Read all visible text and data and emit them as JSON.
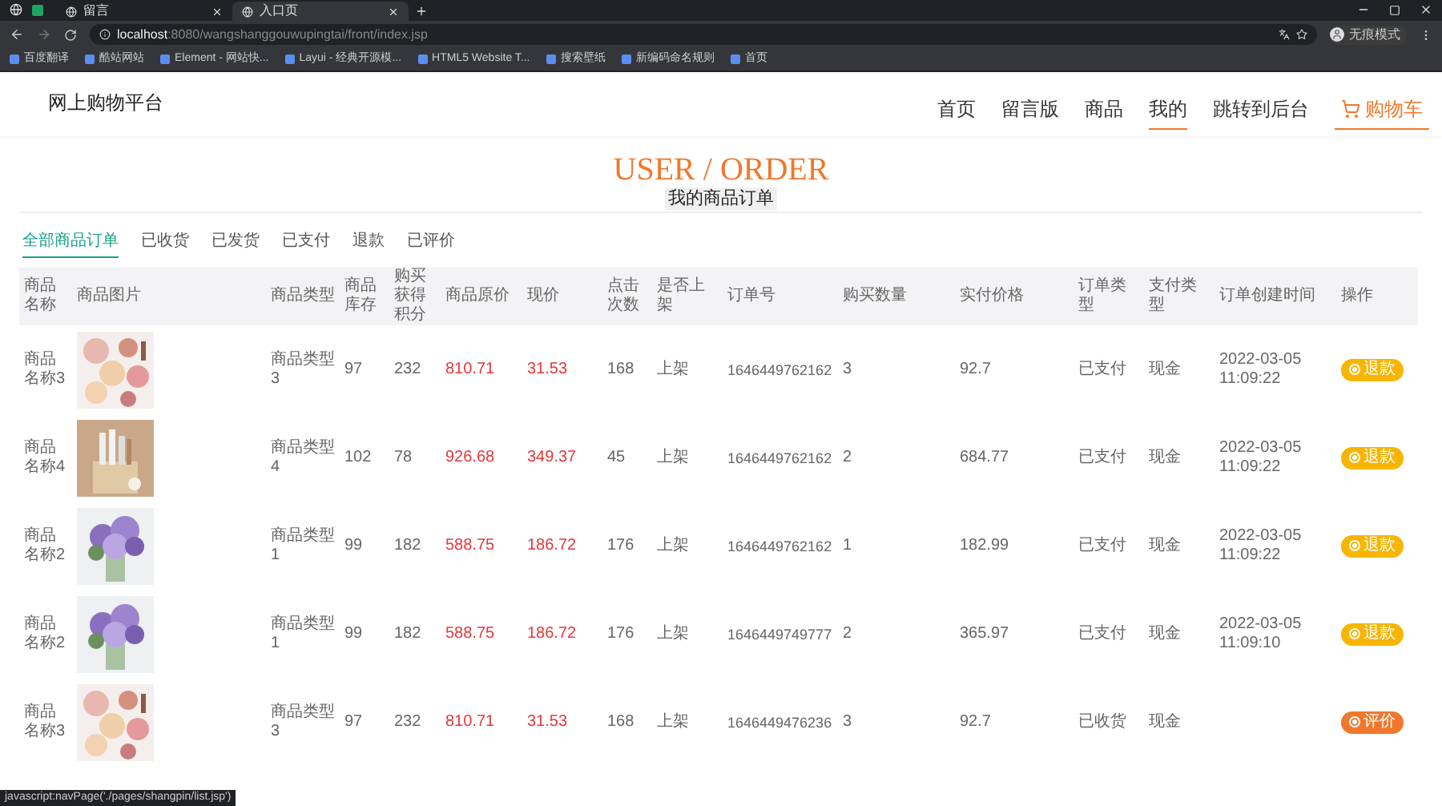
{
  "browser": {
    "tabs": [
      {
        "title": "留言",
        "selected": false
      },
      {
        "title": "入口页",
        "selected": true
      }
    ],
    "url": {
      "host": "localhost",
      "rest": ":8080/wangshanggouwupingtai/front/index.jsp"
    },
    "profile": "无痕模式",
    "bookmarks": [
      "百度翻译",
      "酷站网站",
      "Element - 网站快...",
      "Layui - 经典开源模...",
      "HTML5 Website T...",
      "搜索壁纸",
      "新编码命名规则",
      "首页"
    ],
    "status_url": "javascript:navPage('./pages/shangpin/list.jsp')"
  },
  "site": {
    "logo": "网上购物平台",
    "nav": [
      {
        "label": "首页",
        "selected": false,
        "hover": false,
        "kind": "link"
      },
      {
        "label": "留言版",
        "selected": false,
        "hover": false,
        "kind": "link"
      },
      {
        "label": "商品",
        "selected": false,
        "hover": false,
        "kind": "link"
      },
      {
        "label": "我的",
        "selected": false,
        "hover": true,
        "kind": "link"
      },
      {
        "label": "跳转到后台",
        "selected": false,
        "hover": false,
        "kind": "link"
      },
      {
        "label": "购物车",
        "selected": true,
        "hover": false,
        "kind": "cart"
      }
    ]
  },
  "heading": {
    "title": "USER / ORDER",
    "subtitle": "我的商品订单"
  },
  "order_tabs": [
    {
      "label": "全部商品订单",
      "selected": true
    },
    {
      "label": "已收货",
      "selected": false
    },
    {
      "label": "已发货",
      "selected": false
    },
    {
      "label": "已支付",
      "selected": false
    },
    {
      "label": "退款",
      "selected": false
    },
    {
      "label": "已评价",
      "selected": false
    }
  ],
  "table": {
    "columns": [
      "商品名称",
      "商品图片",
      "商品类型",
      "商品库存",
      "购买获得积分",
      "商品原价",
      "现价",
      "点击次数",
      "是否上架",
      "订单号",
      "购买数量",
      "实付价格",
      "订单类型",
      "支付类型",
      "订单创建时间",
      "操作"
    ],
    "rows": [
      {
        "name": "商品名称3",
        "type": "商品类型3",
        "stock": "97",
        "points": "232",
        "original_price": "810.71",
        "price": "31.53",
        "clicks": "168",
        "on_shelf": "上架",
        "order_no": "1646449762162",
        "quantity": "3",
        "paid": "92.7",
        "order_type": "已支付",
        "pay_type": "现金",
        "created": "2022-03-05 11:09:22",
        "action": {
          "label": "退款",
          "kind": "refund"
        }
      },
      {
        "name": "商品名称4",
        "type": "商品类型4",
        "stock": "102",
        "points": "78",
        "original_price": "926.68",
        "price": "349.37",
        "clicks": "45",
        "on_shelf": "上架",
        "order_no": "1646449762162",
        "quantity": "2",
        "paid": "684.77",
        "order_type": "已支付",
        "pay_type": "现金",
        "created": "2022-03-05 11:09:22",
        "action": {
          "label": "退款",
          "kind": "refund"
        }
      },
      {
        "name": "商品名称2",
        "type": "商品类型1",
        "stock": "99",
        "points": "182",
        "original_price": "588.75",
        "price": "186.72",
        "clicks": "176",
        "on_shelf": "上架",
        "order_no": "1646449762162",
        "quantity": "1",
        "paid": "182.99",
        "order_type": "已支付",
        "pay_type": "现金",
        "created": "2022-03-05 11:09:22",
        "action": {
          "label": "退款",
          "kind": "refund"
        }
      },
      {
        "name": "商品名称2",
        "type": "商品类型1",
        "stock": "99",
        "points": "182",
        "original_price": "588.75",
        "price": "186.72",
        "clicks": "176",
        "on_shelf": "上架",
        "order_no": "1646449749777",
        "quantity": "2",
        "paid": "365.97",
        "order_type": "已支付",
        "pay_type": "现金",
        "created": "2022-03-05 11:09:10",
        "action": {
          "label": "退款",
          "kind": "refund"
        }
      },
      {
        "name": "商品名称3",
        "type": "商品类型3",
        "stock": "97",
        "points": "232",
        "original_price": "810.71",
        "price": "31.53",
        "clicks": "168",
        "on_shelf": "上架",
        "order_no": "1646449476236",
        "quantity": "3",
        "paid": "92.7",
        "order_type": "已收货",
        "pay_type": "现金",
        "action": {
          "label": "评价",
          "kind": "review"
        }
      }
    ]
  }
}
